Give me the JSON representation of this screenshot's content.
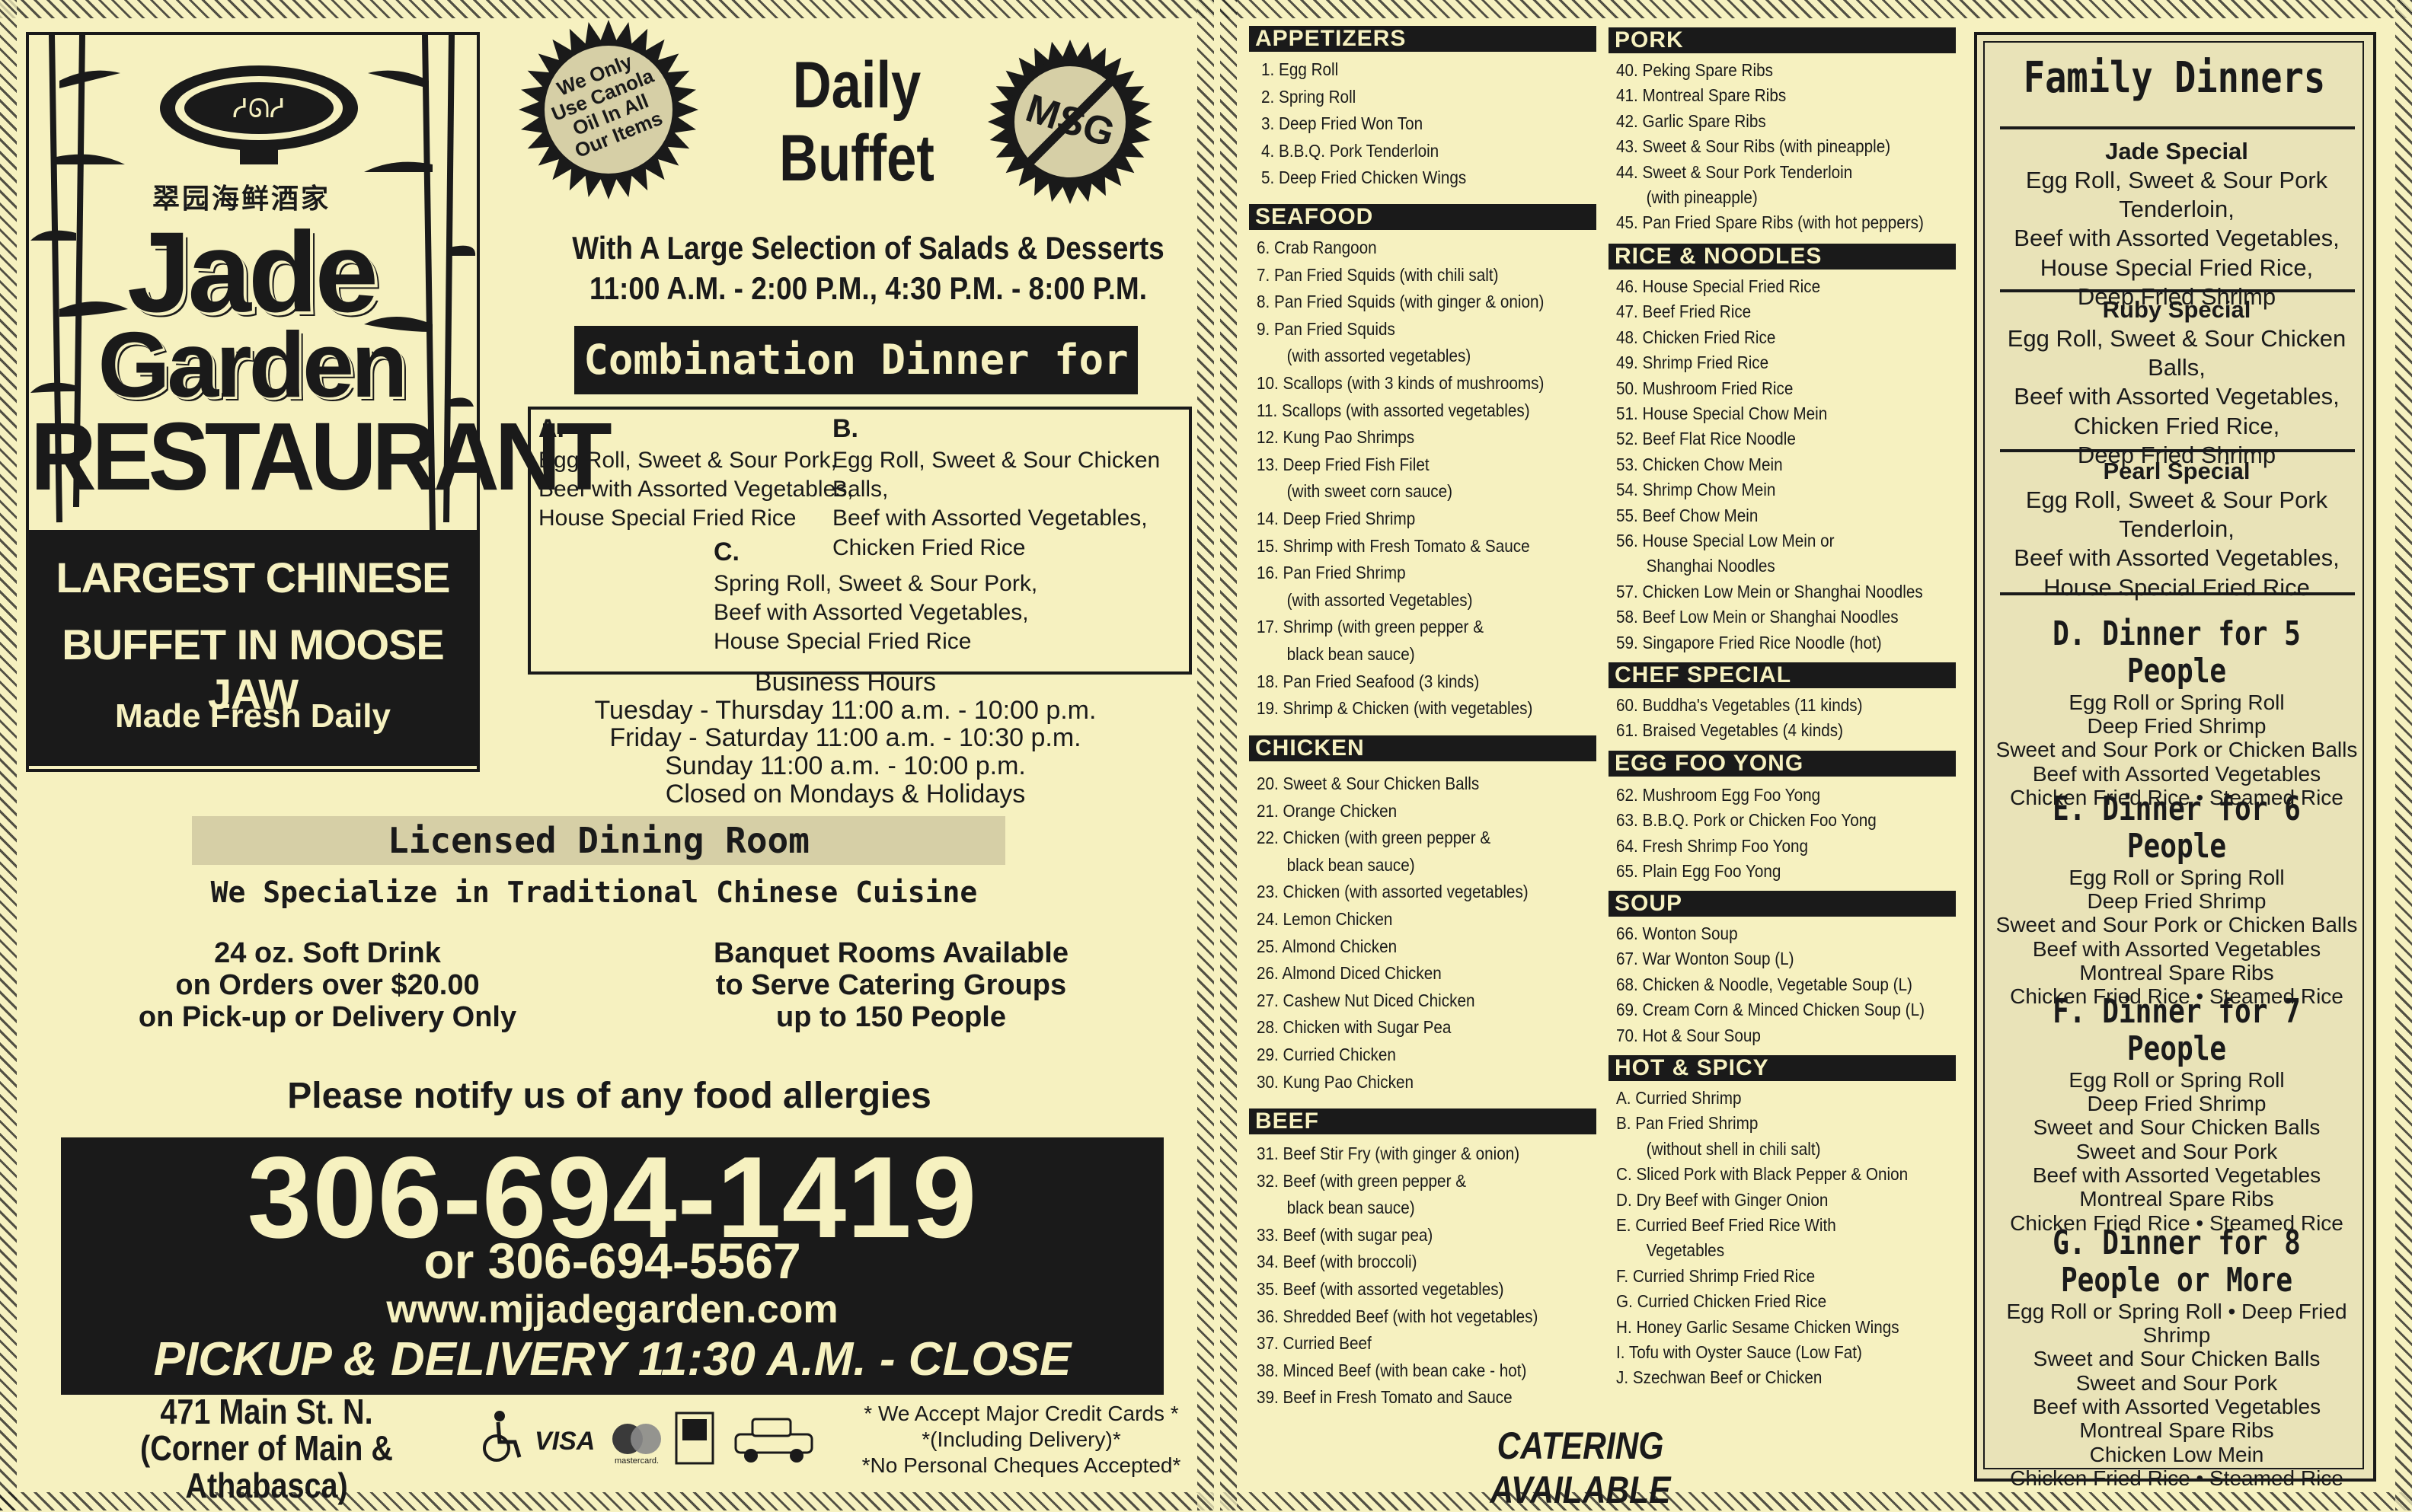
{
  "left": {
    "chinese_name": "翠园海鲜酒家",
    "brand_line1": "Jade",
    "brand_line2": "Garden",
    "brand_line3": "RESTAURANT",
    "tagline1": "LARGEST CHINESE",
    "tagline2": "BUFFET IN MOOSE JAW",
    "tagline3": "Made Fresh Daily",
    "canola_badge": [
      "We Only",
      "Use Canola",
      "Oil In All",
      "Our Items"
    ],
    "daily_buffet": [
      "Daily",
      "Buffet"
    ],
    "msg_text": "MSG",
    "buffet_sub1": "With A Large Selection of Salads & Desserts",
    "buffet_sub2": "11:00 A.M. - 2:00 P.M., 4:30 P.M. - 8:00 P.M.",
    "combo_title": "Combination Dinner for One",
    "combos": {
      "a": {
        "key": "A.",
        "lines": [
          "Egg Roll, Sweet & Sour Pork,",
          "Beef with Assorted Vegetables,",
          "House Special Fried Rice"
        ]
      },
      "b": {
        "key": "B.",
        "lines": [
          "Egg Roll, Sweet & Sour Chicken Balls,",
          "Beef with Assorted Vegetables,",
          "Chicken Fried Rice"
        ]
      },
      "c": {
        "key": "C.",
        "lines": [
          "Spring Roll, Sweet & Sour Pork,",
          "Beef with Assorted Vegetables,",
          "House Special Fried Rice"
        ]
      }
    },
    "hours": [
      "Business Hours",
      "Tuesday - Thursday 11:00 a.m. - 10:00 p.m.",
      "Friday - Saturday 11:00 a.m. - 10:30 p.m.",
      "Sunday 11:00 a.m. - 10:00 p.m.",
      "Closed on Mondays & Holidays"
    ],
    "licensed": "Licensed Dining Room",
    "specialize": "We Specialize in Traditional Chinese Cuisine",
    "soft_drink": [
      "24 oz. Soft Drink",
      "on Orders over $20.00",
      "on Pick-up or Delivery Only"
    ],
    "banquet": [
      "Banquet Rooms Available",
      "to Serve Catering Groups",
      "up to 150 People"
    ],
    "allergies": "Please notify us of any food allergies",
    "phone_main": "306-694-1419",
    "phone_alt": "or 306-694-5567",
    "website": "www.mjjadegarden.com",
    "pickup": "PICKUP & DELIVERY 11:30 A.M. - CLOSE",
    "address1": "471 Main St. N.",
    "address2": "(Corner of Main & Athabasca)",
    "visa": "VISA",
    "mastercard": "mastercard.",
    "credit_note": [
      "* We Accept Major Credit Cards *",
      "*(Including Delivery)*",
      "*No Personal Cheques Accepted*"
    ]
  },
  "menu": {
    "appetizers": {
      "title": "APPETIZERS",
      "items": [
        "1.  Egg Roll",
        "2.  Spring Roll",
        "3.  Deep Fried Won Ton",
        "4.  B.B.Q. Pork Tenderloin",
        "5.  Deep Fried Chicken Wings"
      ]
    },
    "seafood": {
      "title": "SEAFOOD",
      "items": [
        "6.  Crab Rangoon",
        "7.  Pan Fried Squids (with chili salt)",
        "8.  Pan Fried Squids (with ginger & onion)",
        "9.  Pan Fried Squids",
        "(with assorted vegetables)",
        "10. Scallops (with 3 kinds of mushrooms)",
        "11. Scallops (with assorted vegetables)",
        "12. Kung Pao Shrimps",
        "13. Deep Fried Fish Filet",
        "(with sweet corn sauce)",
        "14. Deep Fried Shrimp",
        "15. Shrimp with Fresh Tomato & Sauce",
        "16. Pan Fried Shrimp",
        "(with assorted Vegetables)",
        "17. Shrimp (with green pepper &",
        "black bean sauce)",
        "18. Pan Fried Seafood (3 kinds)",
        "19. Shrimp & Chicken (with vegetables)"
      ]
    },
    "chicken": {
      "title": "CHICKEN",
      "items": [
        "20. Sweet & Sour Chicken Balls",
        "21. Orange Chicken",
        "22. Chicken (with green pepper &",
        "black bean sauce)",
        "23. Chicken (with assorted vegetables)",
        "24. Lemon Chicken",
        "25. Almond Chicken",
        "26. Almond Diced Chicken",
        "27. Cashew Nut Diced Chicken",
        "28. Chicken with Sugar Pea",
        "29. Curried Chicken",
        "30. Kung Pao Chicken"
      ]
    },
    "beef": {
      "title": "BEEF",
      "items": [
        "31. Beef Stir Fry (with ginger & onion)",
        "32. Beef (with green pepper &",
        "black bean sauce)",
        "33. Beef (with sugar pea)",
        "34. Beef (with broccoli)",
        "35. Beef (with assorted vegetables)",
        "36. Shredded Beef (with hot vegetables)",
        "37. Curried Beef",
        "38. Minced Beef (with bean cake - hot)",
        "39. Beef in Fresh Tomato and Sauce"
      ]
    },
    "pork": {
      "title": "PORK",
      "items": [
        "40. Peking Spare Ribs",
        "41. Montreal Spare Ribs",
        "42. Garlic Spare Ribs",
        "43. Sweet & Sour Ribs (with pineapple)",
        "44. Sweet & Sour Pork Tenderloin",
        "(with pineapple)",
        "45. Pan Fried Spare Ribs (with hot peppers)"
      ]
    },
    "rice": {
      "title": "RICE & NOODLES",
      "items": [
        "46. House Special Fried Rice",
        "47. Beef Fried Rice",
        "48. Chicken Fried Rice",
        "49. Shrimp Fried Rice",
        "50. Mushroom Fried Rice",
        "51. House Special Chow Mein",
        "52. Beef Flat Rice Noodle",
        "53. Chicken Chow Mein",
        "54. Shrimp Chow Mein",
        "55. Beef Chow Mein",
        "56. House Special Low Mein or",
        "Shanghai Noodles",
        "57. Chicken Low Mein or Shanghai Noodles",
        "58. Beef Low Mein or Shanghai Noodles",
        "59. Singapore Fried Rice Noodle (hot)"
      ]
    },
    "vegetables": {
      "title": "CHEF SPECIAL VEGETABLES",
      "items": [
        "60. Buddha's Vegetables (11 kinds)",
        "61. Braised Vegetables (4 kinds)"
      ]
    },
    "eggfooyong": {
      "title": "EGG FOO YONG",
      "items": [
        "62. Mushroom Egg Foo Yong",
        "63. B.B.Q. Pork or Chicken Foo Yong",
        "64. Fresh Shrimp Foo Yong",
        "65. Plain Egg Foo Yong"
      ]
    },
    "soup": {
      "title": "SOUP",
      "items": [
        "66. Wonton Soup",
        "67. War Wonton Soup (L)",
        "68. Chicken & Noodle, Vegetable Soup (L)",
        "69. Cream Corn & Minced Chicken Soup (L)",
        "70. Hot & Sour Soup"
      ]
    },
    "hotspicy": {
      "title": "HOT & SPICY",
      "items": [
        "A. Curried Shrimp",
        "B. Pan Fried Shrimp",
        "(without shell in chili salt)",
        "C. Sliced Pork with Black Pepper & Onion",
        "D. Dry Beef with Ginger Onion",
        "E. Curried Beef Fried Rice With",
        "Vegetables",
        "F. Curried Shrimp Fried Rice",
        "G. Curried Chicken Fried Rice",
        "H. Honey Garlic Sesame Chicken Wings",
        "I.  Tofu with Oyster Sauce (Low Fat)",
        "J.  Szechwan Beef or Chicken"
      ]
    },
    "catering": "CATERING AVAILABLE"
  },
  "family": {
    "title": "Family Dinners",
    "jade": {
      "name": "Jade Special",
      "lines": [
        "Egg Roll, Sweet & Sour Pork Tenderloin,",
        "Beef with Assorted Vegetables,",
        "House Special Fried Rice,",
        "Deep Fried Shrimp"
      ]
    },
    "ruby": {
      "name": "Ruby Special",
      "lines": [
        "Egg Roll, Sweet & Sour Chicken Balls,",
        "Beef with Assorted Vegetables,",
        "Chicken Fried Rice,",
        "Deep Fried Shrimp"
      ]
    },
    "pearl": {
      "name": "Pearl Special",
      "lines": [
        "Egg Roll, Sweet & Sour Pork Tenderloin,",
        "Beef with Assorted Vegetables,",
        "House Special Fried Rice"
      ]
    },
    "d": {
      "name": "D. Dinner for 5 People",
      "lines": [
        "Egg Roll or Spring Roll",
        "Deep Fried Shrimp",
        "Sweet and Sour Pork or Chicken Balls",
        "Beef with Assorted Vegetables",
        "Chicken Fried Rice • Steamed Rice"
      ]
    },
    "e": {
      "name": "E. Dinner for 6 People",
      "lines": [
        "Egg Roll or Spring Roll",
        "Deep Fried Shrimp",
        "Sweet and Sour Pork or Chicken Balls",
        "Beef with Assorted Vegetables",
        "Montreal Spare Ribs",
        "Chicken Fried Rice • Steamed Rice"
      ]
    },
    "f": {
      "name": "F. Dinner for 7 People",
      "lines": [
        "Egg Roll or Spring Roll",
        "Deep Fried Shrimp",
        "Sweet and Sour Chicken Balls",
        "Sweet and Sour Pork",
        "Beef with Assorted Vegetables",
        "Montreal Spare Ribs",
        "Chicken Fried Rice • Steamed Rice"
      ]
    },
    "g": {
      "name": "G. Dinner for 8 People or More",
      "lines": [
        "Egg Roll or Spring Roll • Deep Fried Shrimp",
        "Sweet and Sour Chicken Balls",
        "Sweet and Sour Pork",
        "Beef with Assorted Vegetables",
        "Montreal Spare Ribs",
        "Chicken Low Mein",
        "Chicken Fried Rice • Steamed Rice"
      ]
    }
  }
}
